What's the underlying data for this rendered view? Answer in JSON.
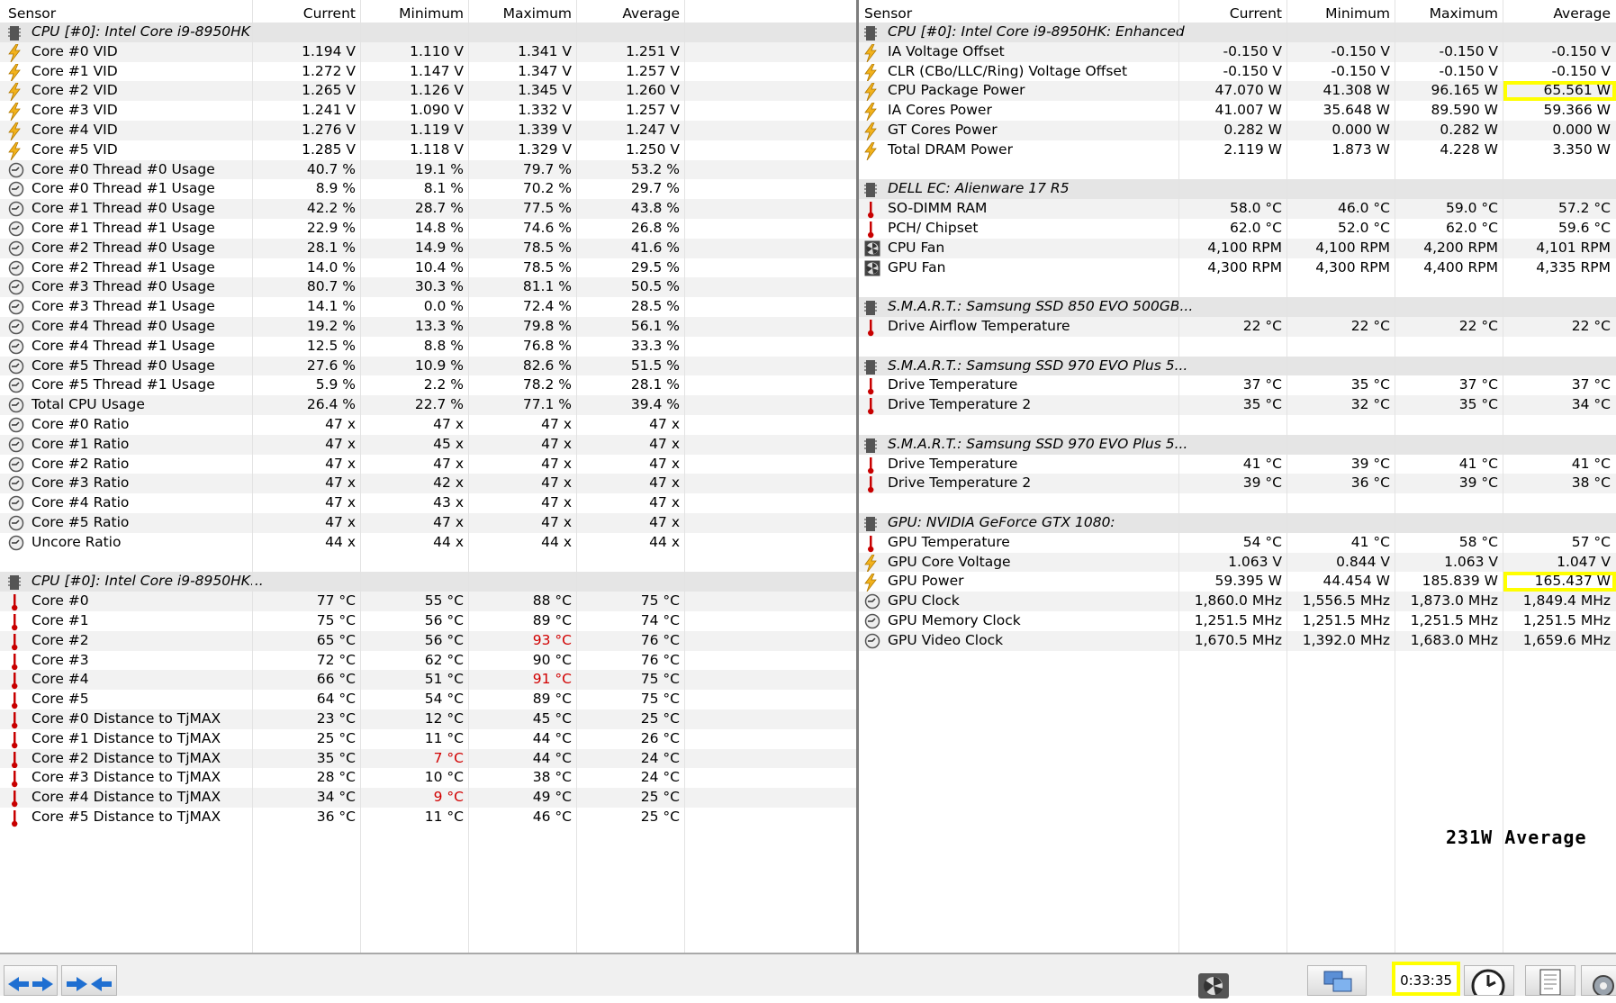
{
  "header": {
    "sensor": "Sensor",
    "current": "Current",
    "minimum": "Minimum",
    "maximum": "Maximum",
    "average": "Average"
  },
  "left": [
    {
      "type": "group",
      "name": "CPU [#0]: Intel Core i9-8950HK"
    },
    {
      "icon": "bolt",
      "name": "Core #0 VID",
      "cur": "1.194 V",
      "min": "1.110 V",
      "max": "1.341 V",
      "avg": "1.251 V"
    },
    {
      "icon": "bolt",
      "name": "Core #1 VID",
      "cur": "1.272 V",
      "min": "1.147 V",
      "max": "1.347 V",
      "avg": "1.257 V"
    },
    {
      "icon": "bolt",
      "name": "Core #2 VID",
      "cur": "1.265 V",
      "min": "1.126 V",
      "max": "1.345 V",
      "avg": "1.260 V"
    },
    {
      "icon": "bolt",
      "name": "Core #3 VID",
      "cur": "1.241 V",
      "min": "1.090 V",
      "max": "1.332 V",
      "avg": "1.257 V"
    },
    {
      "icon": "bolt",
      "name": "Core #4 VID",
      "cur": "1.276 V",
      "min": "1.119 V",
      "max": "1.339 V",
      "avg": "1.247 V"
    },
    {
      "icon": "bolt",
      "name": "Core #5 VID",
      "cur": "1.285 V",
      "min": "1.118 V",
      "max": "1.329 V",
      "avg": "1.250 V"
    },
    {
      "icon": "clock",
      "name": "Core #0 Thread #0 Usage",
      "cur": "40.7 %",
      "min": "19.1 %",
      "max": "79.7 %",
      "avg": "53.2 %"
    },
    {
      "icon": "clock",
      "name": "Core #0 Thread #1 Usage",
      "cur": "8.9 %",
      "min": "8.1 %",
      "max": "70.2 %",
      "avg": "29.7 %"
    },
    {
      "icon": "clock",
      "name": "Core #1 Thread #0 Usage",
      "cur": "42.2 %",
      "min": "28.7 %",
      "max": "77.5 %",
      "avg": "43.8 %"
    },
    {
      "icon": "clock",
      "name": "Core #1 Thread #1 Usage",
      "cur": "22.9 %",
      "min": "14.8 %",
      "max": "74.6 %",
      "avg": "26.8 %"
    },
    {
      "icon": "clock",
      "name": "Core #2 Thread #0 Usage",
      "cur": "28.1 %",
      "min": "14.9 %",
      "max": "78.5 %",
      "avg": "41.6 %"
    },
    {
      "icon": "clock",
      "name": "Core #2 Thread #1 Usage",
      "cur": "14.0 %",
      "min": "10.4 %",
      "max": "78.5 %",
      "avg": "29.5 %"
    },
    {
      "icon": "clock",
      "name": "Core #3 Thread #0 Usage",
      "cur": "80.7 %",
      "min": "30.3 %",
      "max": "81.1 %",
      "avg": "50.5 %"
    },
    {
      "icon": "clock",
      "name": "Core #3 Thread #1 Usage",
      "cur": "14.1 %",
      "min": "0.0 %",
      "max": "72.4 %",
      "avg": "28.5 %"
    },
    {
      "icon": "clock",
      "name": "Core #4 Thread #0 Usage",
      "cur": "19.2 %",
      "min": "13.3 %",
      "max": "79.8 %",
      "avg": "56.1 %"
    },
    {
      "icon": "clock",
      "name": "Core #4 Thread #1 Usage",
      "cur": "12.5 %",
      "min": "8.8 %",
      "max": "76.8 %",
      "avg": "33.3 %"
    },
    {
      "icon": "clock",
      "name": "Core #5 Thread #0 Usage",
      "cur": "27.6 %",
      "min": "10.9 %",
      "max": "82.6 %",
      "avg": "51.5 %"
    },
    {
      "icon": "clock",
      "name": "Core #5 Thread #1 Usage",
      "cur": "5.9 %",
      "min": "2.2 %",
      "max": "78.2 %",
      "avg": "28.1 %"
    },
    {
      "icon": "clock",
      "name": "Total CPU Usage",
      "cur": "26.4 %",
      "min": "22.7 %",
      "max": "77.1 %",
      "avg": "39.4 %"
    },
    {
      "icon": "clock",
      "name": "Core #0 Ratio",
      "cur": "47 x",
      "min": "47 x",
      "max": "47 x",
      "avg": "47 x"
    },
    {
      "icon": "clock",
      "name": "Core #1 Ratio",
      "cur": "47 x",
      "min": "45 x",
      "max": "47 x",
      "avg": "47 x"
    },
    {
      "icon": "clock",
      "name": "Core #2 Ratio",
      "cur": "47 x",
      "min": "47 x",
      "max": "47 x",
      "avg": "47 x"
    },
    {
      "icon": "clock",
      "name": "Core #3 Ratio",
      "cur": "47 x",
      "min": "42 x",
      "max": "47 x",
      "avg": "47 x"
    },
    {
      "icon": "clock",
      "name": "Core #4 Ratio",
      "cur": "47 x",
      "min": "43 x",
      "max": "47 x",
      "avg": "47 x"
    },
    {
      "icon": "clock",
      "name": "Core #5 Ratio",
      "cur": "47 x",
      "min": "47 x",
      "max": "47 x",
      "avg": "47 x"
    },
    {
      "icon": "clock",
      "name": "Uncore Ratio",
      "cur": "44 x",
      "min": "44 x",
      "max": "44 x",
      "avg": "44 x"
    },
    {
      "type": "blank"
    },
    {
      "type": "group",
      "name": "CPU [#0]: Intel Core i9-8950HK..."
    },
    {
      "icon": "therm",
      "name": "Core #0",
      "cur": "77 °C",
      "min": "55 °C",
      "max": "88 °C",
      "avg": "75 °C"
    },
    {
      "icon": "therm",
      "name": "Core #1",
      "cur": "75 °C",
      "min": "56 °C",
      "max": "89 °C",
      "avg": "74 °C"
    },
    {
      "icon": "therm",
      "name": "Core #2",
      "cur": "65 °C",
      "min": "56 °C",
      "max": "93 °C",
      "avg": "76 °C",
      "red": "max"
    },
    {
      "icon": "therm",
      "name": "Core #3",
      "cur": "72 °C",
      "min": "62 °C",
      "max": "90 °C",
      "avg": "76 °C"
    },
    {
      "icon": "therm",
      "name": "Core #4",
      "cur": "66 °C",
      "min": "51 °C",
      "max": "91 °C",
      "avg": "75 °C",
      "red": "max"
    },
    {
      "icon": "therm",
      "name": "Core #5",
      "cur": "64 °C",
      "min": "54 °C",
      "max": "89 °C",
      "avg": "75 °C"
    },
    {
      "icon": "therm",
      "name": "Core #0 Distance to TjMAX",
      "cur": "23 °C",
      "min": "12 °C",
      "max": "45 °C",
      "avg": "25 °C"
    },
    {
      "icon": "therm",
      "name": "Core #1 Distance to TjMAX",
      "cur": "25 °C",
      "min": "11 °C",
      "max": "44 °C",
      "avg": "26 °C"
    },
    {
      "icon": "therm",
      "name": "Core #2 Distance to TjMAX",
      "cur": "35 °C",
      "min": "7 °C",
      "max": "44 °C",
      "avg": "24 °C",
      "red": "min"
    },
    {
      "icon": "therm",
      "name": "Core #3 Distance to TjMAX",
      "cur": "28 °C",
      "min": "10 °C",
      "max": "38 °C",
      "avg": "24 °C"
    },
    {
      "icon": "therm",
      "name": "Core #4 Distance to TjMAX",
      "cur": "34 °C",
      "min": "9 °C",
      "max": "49 °C",
      "avg": "25 °C",
      "red": "min"
    },
    {
      "icon": "therm",
      "name": "Core #5 Distance to TjMAX",
      "cur": "36 °C",
      "min": "11 °C",
      "max": "46 °C",
      "avg": "25 °C"
    }
  ],
  "right": [
    {
      "type": "group",
      "name": "CPU [#0]: Intel Core i9-8950HK: Enhanced"
    },
    {
      "icon": "bolt",
      "name": "IA Voltage Offset",
      "cur": "-0.150 V",
      "min": "-0.150 V",
      "max": "-0.150 V",
      "avg": "-0.150 V"
    },
    {
      "icon": "bolt",
      "name": "CLR (CBo/LLC/Ring) Voltage Offset",
      "cur": "-0.150 V",
      "min": "-0.150 V",
      "max": "-0.150 V",
      "avg": "-0.150 V"
    },
    {
      "icon": "bolt",
      "name": "CPU Package Power",
      "cur": "47.070 W",
      "min": "41.308 W",
      "max": "96.165 W",
      "avg": "65.561 W",
      "hl": "avg"
    },
    {
      "icon": "bolt",
      "name": "IA Cores Power",
      "cur": "41.007 W",
      "min": "35.648 W",
      "max": "89.590 W",
      "avg": "59.366 W"
    },
    {
      "icon": "bolt",
      "name": "GT Cores Power",
      "cur": "0.282 W",
      "min": "0.000 W",
      "max": "0.282 W",
      "avg": "0.000 W"
    },
    {
      "icon": "bolt",
      "name": "Total DRAM Power",
      "cur": "2.119 W",
      "min": "1.873 W",
      "max": "4.228 W",
      "avg": "3.350 W"
    },
    {
      "type": "blank"
    },
    {
      "type": "group",
      "name": "DELL EC: Alienware 17 R5"
    },
    {
      "icon": "therm",
      "name": "SO-DIMM RAM",
      "cur": "58.0 °C",
      "min": "46.0 °C",
      "max": "59.0 °C",
      "avg": "57.2 °C"
    },
    {
      "icon": "therm",
      "name": "PCH/ Chipset",
      "cur": "62.0 °C",
      "min": "52.0 °C",
      "max": "62.0 °C",
      "avg": "59.6 °C"
    },
    {
      "icon": "fan",
      "name": "CPU Fan",
      "cur": "4,100 RPM",
      "min": "4,100 RPM",
      "max": "4,200 RPM",
      "avg": "4,101 RPM"
    },
    {
      "icon": "fan",
      "name": "GPU Fan",
      "cur": "4,300 RPM",
      "min": "4,300 RPM",
      "max": "4,400 RPM",
      "avg": "4,335 RPM"
    },
    {
      "type": "blank"
    },
    {
      "type": "group",
      "name": "S.M.A.R.T.: Samsung SSD 850 EVO 500GB..."
    },
    {
      "icon": "therm",
      "name": "Drive Airflow Temperature",
      "cur": "22 °C",
      "min": "22 °C",
      "max": "22 °C",
      "avg": "22 °C"
    },
    {
      "type": "blank"
    },
    {
      "type": "group",
      "name": "S.M.A.R.T.: Samsung SSD 970 EVO Plus 5..."
    },
    {
      "icon": "therm",
      "name": "Drive Temperature",
      "cur": "37 °C",
      "min": "35 °C",
      "max": "37 °C",
      "avg": "37 °C"
    },
    {
      "icon": "therm",
      "name": "Drive Temperature 2",
      "cur": "35 °C",
      "min": "32 °C",
      "max": "35 °C",
      "avg": "34 °C"
    },
    {
      "type": "blank"
    },
    {
      "type": "group",
      "name": "S.M.A.R.T.: Samsung SSD 970 EVO Plus 5..."
    },
    {
      "icon": "therm",
      "name": "Drive Temperature",
      "cur": "41 °C",
      "min": "39 °C",
      "max": "41 °C",
      "avg": "41 °C"
    },
    {
      "icon": "therm",
      "name": "Drive Temperature 2",
      "cur": "39 °C",
      "min": "36 °C",
      "max": "39 °C",
      "avg": "38 °C"
    },
    {
      "type": "blank"
    },
    {
      "type": "group",
      "name": "GPU: NVIDIA GeForce GTX 1080:"
    },
    {
      "icon": "therm",
      "name": "GPU Temperature",
      "cur": "54 °C",
      "min": "41 °C",
      "max": "58 °C",
      "avg": "57 °C"
    },
    {
      "icon": "bolt",
      "name": "GPU Core Voltage",
      "cur": "1.063 V",
      "min": "0.844 V",
      "max": "1.063 V",
      "avg": "1.047 V"
    },
    {
      "icon": "bolt",
      "name": "GPU Power",
      "cur": "59.395 W",
      "min": "44.454 W",
      "max": "185.839 W",
      "avg": "165.437 W",
      "hl": "avg"
    },
    {
      "icon": "clock",
      "name": "GPU Clock",
      "cur": "1,860.0 MHz",
      "min": "1,556.5 MHz",
      "max": "1,873.0 MHz",
      "avg": "1,849.4 MHz"
    },
    {
      "icon": "clock",
      "name": "GPU Memory Clock",
      "cur": "1,251.5 MHz",
      "min": "1,251.5 MHz",
      "max": "1,251.5 MHz",
      "avg": "1,251.5 MHz"
    },
    {
      "icon": "clock",
      "name": "GPU Video Clock",
      "cur": "1,670.5 MHz",
      "min": "1,392.0 MHz",
      "max": "1,683.0 MHz",
      "avg": "1,659.6 MHz"
    }
  ],
  "annotation": "231W Average",
  "statusbar": {
    "timer": "0:33:35"
  },
  "colors": {
    "group_bg": "#e5e5e5",
    "alt_row": "#f2f2f2",
    "highlight": "#ffff00",
    "alert_text": "#d10000"
  }
}
